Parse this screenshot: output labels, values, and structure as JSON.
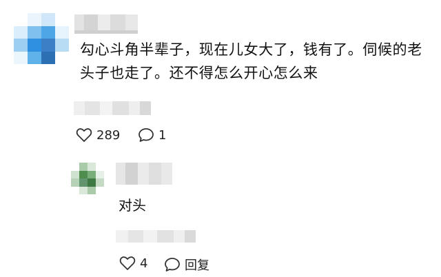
{
  "comment": {
    "text": "勾心斗角半辈子，现在儿女大了，钱有了。伺候的老头子也走了。还不得怎么开心怎么来",
    "like_count": "289",
    "reply_count": "1",
    "icons": {
      "like": "heart-outline-icon",
      "reply": "speech-bubble-icon"
    }
  },
  "reply": {
    "text": "对头",
    "like_count": "4",
    "reply_label": "回复",
    "icons": {
      "like": "heart-outline-icon",
      "reply": "speech-bubble-icon"
    }
  },
  "colors": {
    "avatar_main": [
      "#2f8fe0",
      "#5fb1ea",
      "#9ccff2",
      "#dbeefb",
      "#3c7fc7",
      "#7fc0ee"
    ],
    "avatar_reply": [
      "#4e8d4e",
      "#79ad79",
      "#a9cba9",
      "#d9e8d9",
      "#62956d"
    ],
    "blur_gray": [
      "#d6d6d6",
      "#e6e6e6",
      "#c8c8c8",
      "#f0f0f0"
    ]
  }
}
